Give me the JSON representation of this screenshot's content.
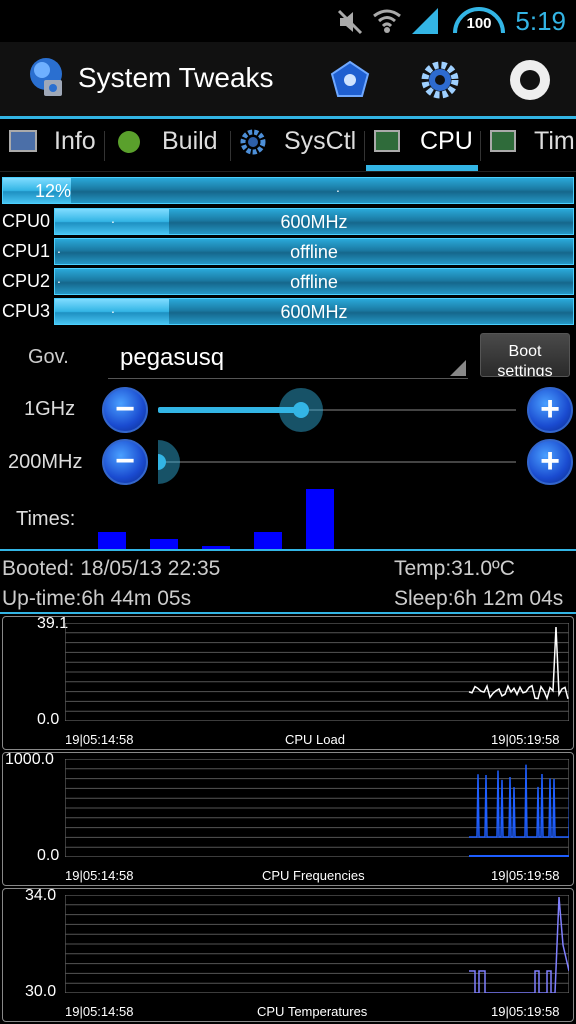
{
  "status_bar": {
    "time": "5:19",
    "battery": "100",
    "icons": [
      "muted-icon",
      "wifi-icon",
      "signal-icon",
      "battery-icon"
    ]
  },
  "app": {
    "title": "System Tweaks",
    "actions": [
      "app-icon",
      "settings-gear-icon",
      "record-icon"
    ]
  },
  "tabs": [
    {
      "label": "Info",
      "icon": "monitor-icon"
    },
    {
      "label": "Build",
      "icon": "android-icon"
    },
    {
      "label": "SysCtl",
      "icon": "gear-icon"
    },
    {
      "label": "CPU",
      "icon": "chip-icon",
      "selected": true
    },
    {
      "label": "Tim",
      "icon": "chip-icon"
    }
  ],
  "cpu": {
    "total_label": "12%",
    "total_fraction": 0.12,
    "cores": [
      {
        "name": "CPU0",
        "value": "600MHz",
        "fraction": 0.22
      },
      {
        "name": "CPU1",
        "value": "offline",
        "fraction": 0.0
      },
      {
        "name": "CPU2",
        "value": "offline",
        "fraction": 0.0
      },
      {
        "name": "CPU3",
        "value": "600MHz",
        "fraction": 0.22
      }
    ]
  },
  "governor": {
    "label": "Gov.",
    "value": "pegasusq",
    "boot_button": "Boot settings"
  },
  "sliders": {
    "max": {
      "label": "1GHz",
      "fraction": 0.4
    },
    "min": {
      "label": "200MHz",
      "fraction": 0.0
    }
  },
  "times": {
    "label": "Times:",
    "values": [
      0.28,
      0.16,
      0.06,
      0.28,
      0.92
    ]
  },
  "info": {
    "booted": "Booted:  18/05/13 22:35",
    "uptime": "Up-time:6h 44m 05s",
    "temp": "Temp:31.0ºC",
    "sleep": "Sleep:6h 12m 04s"
  },
  "graphs": [
    {
      "name": "CPU Load",
      "max": "39.1",
      "min": "0.0",
      "start": "19|05:14:58",
      "end": "19|05:19:58"
    },
    {
      "name": "CPU Frequencies",
      "max": "1000.0",
      "min": "0.0",
      "start": "19|05:14:58",
      "end": "19|05:19:58"
    },
    {
      "name": "CPU Temperatures",
      "max": "34.0",
      "min": "30.0",
      "start": "19|05:14:58",
      "end": "19|05:19:58"
    }
  ],
  "colors": {
    "accent": "#33b5e5",
    "times_bar": "#0000ff",
    "load_line": "#ffffff",
    "freq_line": "#1e5eff",
    "temp_line": "#8080ff"
  }
}
